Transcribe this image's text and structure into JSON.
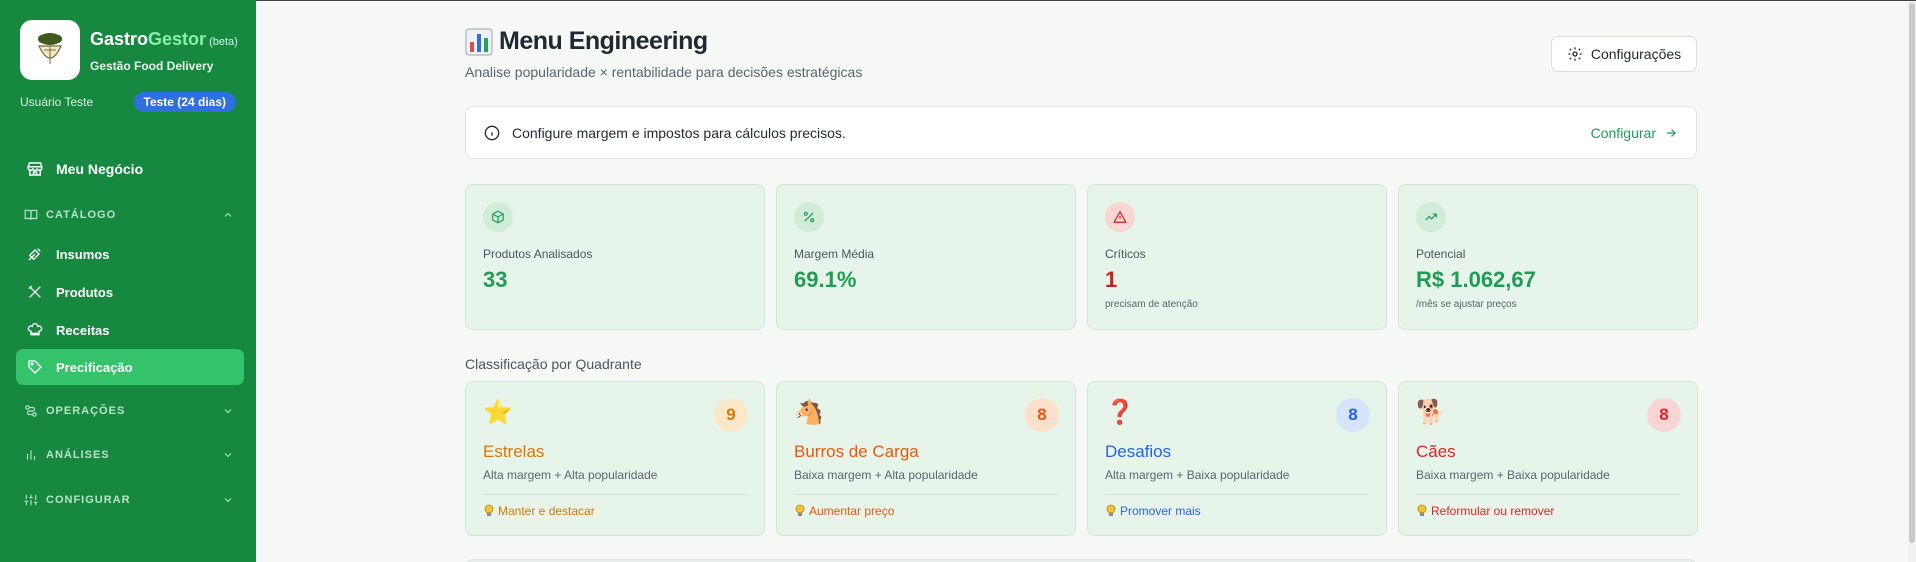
{
  "sidebar": {
    "brand": {
      "name_part1": "Gastro",
      "name_part2": "Gestor",
      "beta": "(beta)",
      "subtitle": "Gestão Food Delivery"
    },
    "user": {
      "name": "Usuário Teste",
      "trial": "Teste (24 dias)"
    },
    "nav": {
      "meu_negocio": "Meu Negócio",
      "catalogo": "CATÁLOGO",
      "insumos": "Insumos",
      "produtos": "Produtos",
      "receitas": "Receitas",
      "precificacao": "Precificação",
      "operacoes": "OPERAÇÕES",
      "analises": "ANÁLISES",
      "configurar": "CONFIGURAR"
    },
    "colors": {
      "background": "#16883f",
      "active": "#34c26a",
      "badge": "#2f6fdf"
    }
  },
  "header": {
    "title": "Menu Engineering",
    "subtitle": "Analise popularidade × rentabilidade para decisões estratégicas",
    "config_button": "Configurações",
    "title_icon": "bar-chart-emoji"
  },
  "alert": {
    "text": "Configure margem e impostos para cálculos precisos.",
    "link": "Configurar"
  },
  "stats": [
    {
      "label": "Produtos Analisados",
      "value": "33",
      "note": "",
      "icon": "package-icon",
      "tone": "green"
    },
    {
      "label": "Margem Média",
      "value": "69.1%",
      "note": "",
      "icon": "percent-icon",
      "tone": "green"
    },
    {
      "label": "Críticos",
      "value": "1",
      "note": "precisam de atenção",
      "icon": "warning-icon",
      "tone": "red"
    },
    {
      "label": "Potencial",
      "value": "R$ 1.062,67",
      "note": "/mês se ajustar preços",
      "icon": "trending-up-icon",
      "tone": "green"
    }
  ],
  "quadrants": {
    "title": "Classificação por Quadrante",
    "items": [
      {
        "emoji": "⭐",
        "count": "9",
        "name": "Estrelas",
        "desc": "Alta margem + Alta popularidade",
        "action": "Manter e destacar",
        "color": "#d97706",
        "badge_bg": "#fbe8c8"
      },
      {
        "emoji": "🐴",
        "count": "8",
        "name": "Burros de Carga",
        "desc": "Baixa margem + Alta popularidade",
        "action": "Aumentar preço",
        "color": "#ea580c",
        "badge_bg": "#fde0cc"
      },
      {
        "emoji": "❓",
        "count": "8",
        "name": "Desafios",
        "desc": "Alta margem + Baixa popularidade",
        "action": "Promover mais",
        "color": "#2563eb",
        "badge_bg": "#d6e4fb"
      },
      {
        "emoji": "🐕",
        "count": "8",
        "name": "Cães",
        "desc": "Baixa margem + Baixa popularidade",
        "action": "Reformular ou remover",
        "color": "#dc2626",
        "badge_bg": "#f8d5d3"
      }
    ]
  }
}
